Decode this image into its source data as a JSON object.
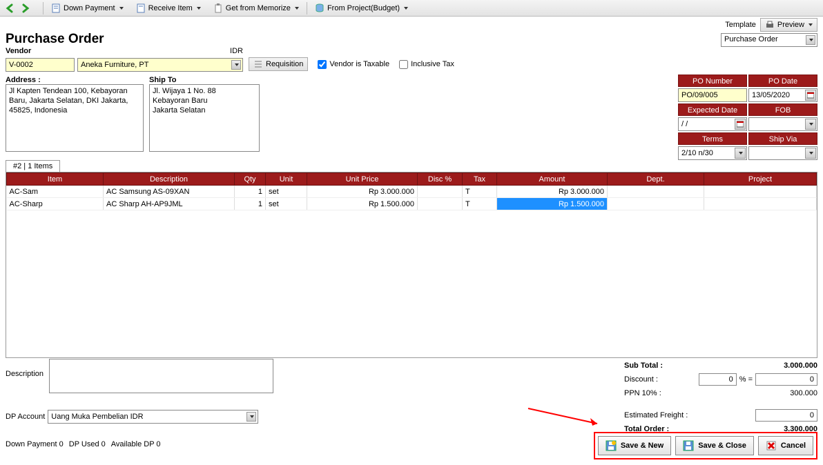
{
  "toolbar": {
    "down_payment": "Down Payment",
    "receive_item": "Receive Item",
    "get_memorize": "Get from Memorize",
    "from_project": "From Project(Budget)"
  },
  "title": "Purchase Order",
  "template_label": "Template",
  "preview_label": "Preview",
  "template_value": "Purchase Order",
  "vendor": {
    "label": "Vendor",
    "currency": "IDR",
    "code": "V-0002",
    "name": "Aneka Furniture, PT",
    "requisition": "Requisition",
    "taxable_label": "Vendor is Taxable",
    "taxable_checked": true,
    "inclusive_label": "Inclusive Tax",
    "inclusive_checked": false
  },
  "address": {
    "label": "Address :",
    "text": "Jl Kapten Tendean 100, Kebayoran Baru, Jakarta Selatan, DKI Jakarta, 45825, Indonesia"
  },
  "shipto": {
    "label": "Ship To",
    "text": "Jl. Wijaya 1 No. 88\nKebayoran Baru\nJakarta Selatan"
  },
  "po": {
    "number_hdr": "PO Number",
    "number": "PO/09/005",
    "date_hdr": "PO Date",
    "date": "13/05/2020",
    "expected_hdr": "Expected Date",
    "expected": "/  /",
    "fob_hdr": "FOB",
    "fob": "",
    "terms_hdr": "Terms",
    "terms": "2/10 n/30",
    "shipvia_hdr": "Ship Via",
    "shipvia": ""
  },
  "tab_label": "#2 | 1 Items",
  "cols": {
    "item": "Item",
    "desc": "Description",
    "qty": "Qty",
    "unit": "Unit",
    "uprice": "Unit Price",
    "disc": "Disc %",
    "tax": "Tax",
    "amount": "Amount",
    "dept": "Dept.",
    "project": "Project"
  },
  "rows": [
    {
      "item": "AC-Sam",
      "desc": "AC Samsung AS-09XAN",
      "qty": "1",
      "unit": "set",
      "uprice": "Rp 3.000.000",
      "disc": "",
      "tax": "T",
      "amount": "Rp 3.000.000",
      "dept": "",
      "project": ""
    },
    {
      "item": "AC-Sharp",
      "desc": "AC Sharp AH-AP9JML",
      "qty": "1",
      "unit": "set",
      "uprice": "Rp 1.500.000",
      "disc": "",
      "tax": "T",
      "amount": "Rp 1.500.000",
      "dept": "",
      "project": "",
      "selected_amount": true
    }
  ],
  "desc_label": "Description",
  "dp_label": "DP Account",
  "dp_value": "Uang Muka Pembelian IDR",
  "totals": {
    "subtotal_lbl": "Sub Total :",
    "subtotal": "3.000.000",
    "discount_lbl": "Discount :",
    "discount_pct": "0",
    "discount_amt": "0",
    "pct_sep": "% =",
    "ppn_lbl": "PPN 10% :",
    "ppn": "300.000",
    "freight_lbl": "Estimated Freight :",
    "freight": "0",
    "total_lbl": "Total Order :",
    "total": "3.300.000"
  },
  "status": {
    "dp": "Down Payment 0",
    "dpused": "DP Used 0",
    "avail": "Available DP 0"
  },
  "actions": {
    "savenew": "Save & New",
    "saveclose": "Save & Close",
    "cancel": "Cancel"
  }
}
